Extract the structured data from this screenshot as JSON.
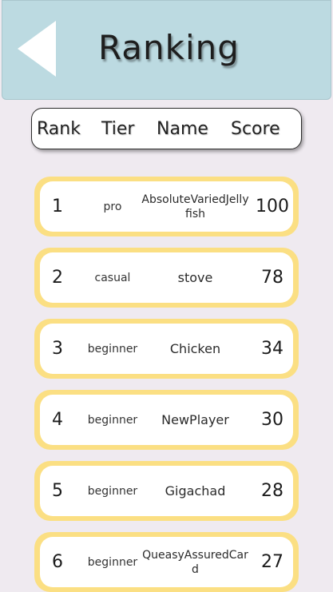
{
  "header": {
    "title": "Ranking"
  },
  "columns": {
    "rank": "Rank",
    "tier": "Tier",
    "name": "Name",
    "score": "Score"
  },
  "rows": [
    {
      "rank": "1",
      "tier": "pro",
      "name": "AbsoluteVariedJellyfish",
      "score": "100"
    },
    {
      "rank": "2",
      "tier": "casual",
      "name": "stove",
      "score": "78"
    },
    {
      "rank": "3",
      "tier": "beginner",
      "name": "Chicken",
      "score": "34"
    },
    {
      "rank": "4",
      "tier": "beginner",
      "name": "NewPlayer",
      "score": "30"
    },
    {
      "rank": "5",
      "tier": "beginner",
      "name": "Gigachad",
      "score": "28"
    },
    {
      "rank": "6",
      "tier": "beginner",
      "name": "QueasyAssuredCard",
      "score": "27"
    }
  ],
  "colors": {
    "header_bg": "#bcdae1",
    "page_bg": "#efeaf0",
    "row_border": "#fbdf83"
  }
}
